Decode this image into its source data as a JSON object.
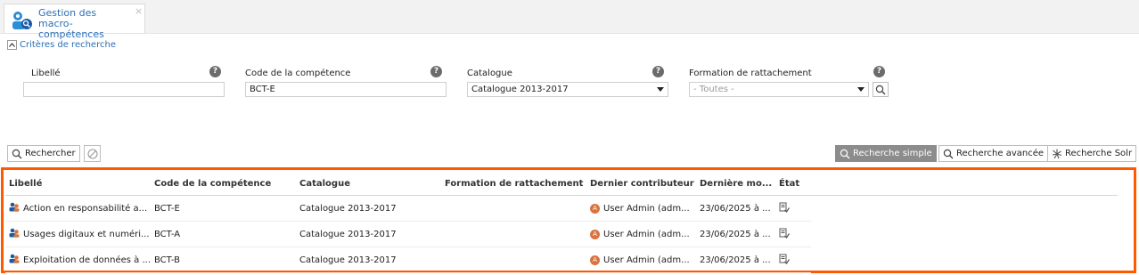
{
  "tab": {
    "title": "Gestion des macro-compétences",
    "close": "×"
  },
  "criteria": {
    "toggle_label": "Critères de recherche"
  },
  "fields": {
    "libelle": {
      "label": "Libellé",
      "value": ""
    },
    "code": {
      "label": "Code de la compétence",
      "value": "BCT-E"
    },
    "catalogue": {
      "label": "Catalogue",
      "value": "Catalogue 2013-2017"
    },
    "formation": {
      "label": "Formation de rattachement",
      "placeholder": "- Toutes -"
    },
    "help_glyph": "?"
  },
  "actions": {
    "search": "Rechercher",
    "simple": "Recherche simple",
    "advanced": "Recherche avancée",
    "solr": "Recherche Solr"
  },
  "table": {
    "columns": [
      "Libellé",
      "Code de la compétence",
      "Catalogue",
      "Formation de rattachement",
      "Dernier contributeur",
      "Dernière mo...",
      "État"
    ],
    "rows": [
      {
        "libelle": "Action en responsabilité a...",
        "code": "BCT-E",
        "catalogue": "Catalogue 2013-2017",
        "formation": "",
        "avatar": "A",
        "contributeur": "User Admin (adm...",
        "date": "23/06/2025 à ..."
      },
      {
        "libelle": "Usages digitaux et numéri...",
        "code": "BCT-A",
        "catalogue": "Catalogue 2013-2017",
        "formation": "",
        "avatar": "A",
        "contributeur": "User Admin (adm...",
        "date": "23/06/2025 à ..."
      },
      {
        "libelle": "Exploitation de données à ...",
        "code": "BCT-B",
        "catalogue": "Catalogue 2013-2017",
        "formation": "",
        "avatar": "A",
        "contributeur": "User Admin (adm...",
        "date": "23/06/2025 à ..."
      }
    ]
  },
  "colors": {
    "accent": "#2b6fb5",
    "highlight": "#ff5a00",
    "avatar": "#d9733f",
    "active_button": "#8c8c8c"
  },
  "icons": [
    "competences-tab-icon",
    "chevron-up-icon",
    "help-icon",
    "search-icon",
    "reset-icon",
    "solr-icon",
    "competence-row-icon",
    "avatar-icon",
    "edit-status-icon"
  ]
}
